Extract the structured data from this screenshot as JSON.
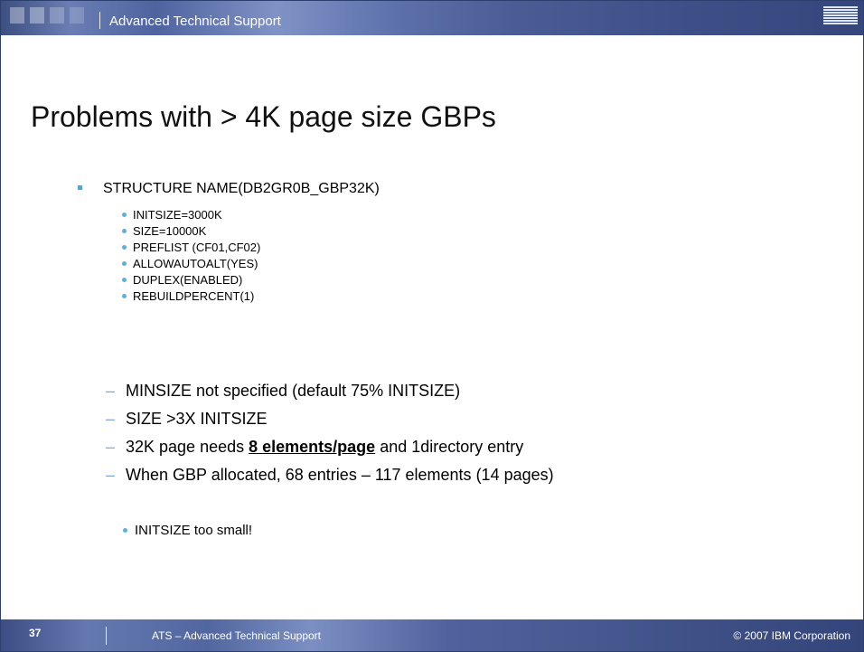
{
  "header": {
    "title": "Advanced Technical Support",
    "logo": "IBM"
  },
  "slide": {
    "title": "Problems with > 4K page size GBPs"
  },
  "structure": {
    "label": "STRUCTURE NAME(DB2GR0B_GBP32K)",
    "items": [
      "INITSIZE=3000K",
      "SIZE=10000K",
      "PREFLIST (CF01,CF02)",
      "ALLOWAUTOALT(YES)",
      "DUPLEX(ENABLED)",
      "REBUILDPERCENT(1)"
    ]
  },
  "points": [
    {
      "pre": "MINSIZE not specified (default 75% INITSIZE)",
      "bold": "",
      "post": ""
    },
    {
      "pre": "SIZE >3X INITSIZE",
      "bold": "",
      "post": ""
    },
    {
      "pre": "32K page needs ",
      "bold": "8 elements/page",
      "post": " and 1directory entry"
    },
    {
      "pre": "When GBP allocated, 68 entries – 117 elements (14 pages)",
      "bold": "",
      "post": ""
    }
  ],
  "sub_points": [
    "INITSIZE too small!"
  ],
  "footer": {
    "page_number": "37",
    "left": "ATS – Advanced Technical Support",
    "right": "© 2007 IBM Corporation"
  },
  "colors": {
    "header": "#4a5c93",
    "bullet": "#4fa7d6",
    "dash": "#7fa9d1"
  }
}
